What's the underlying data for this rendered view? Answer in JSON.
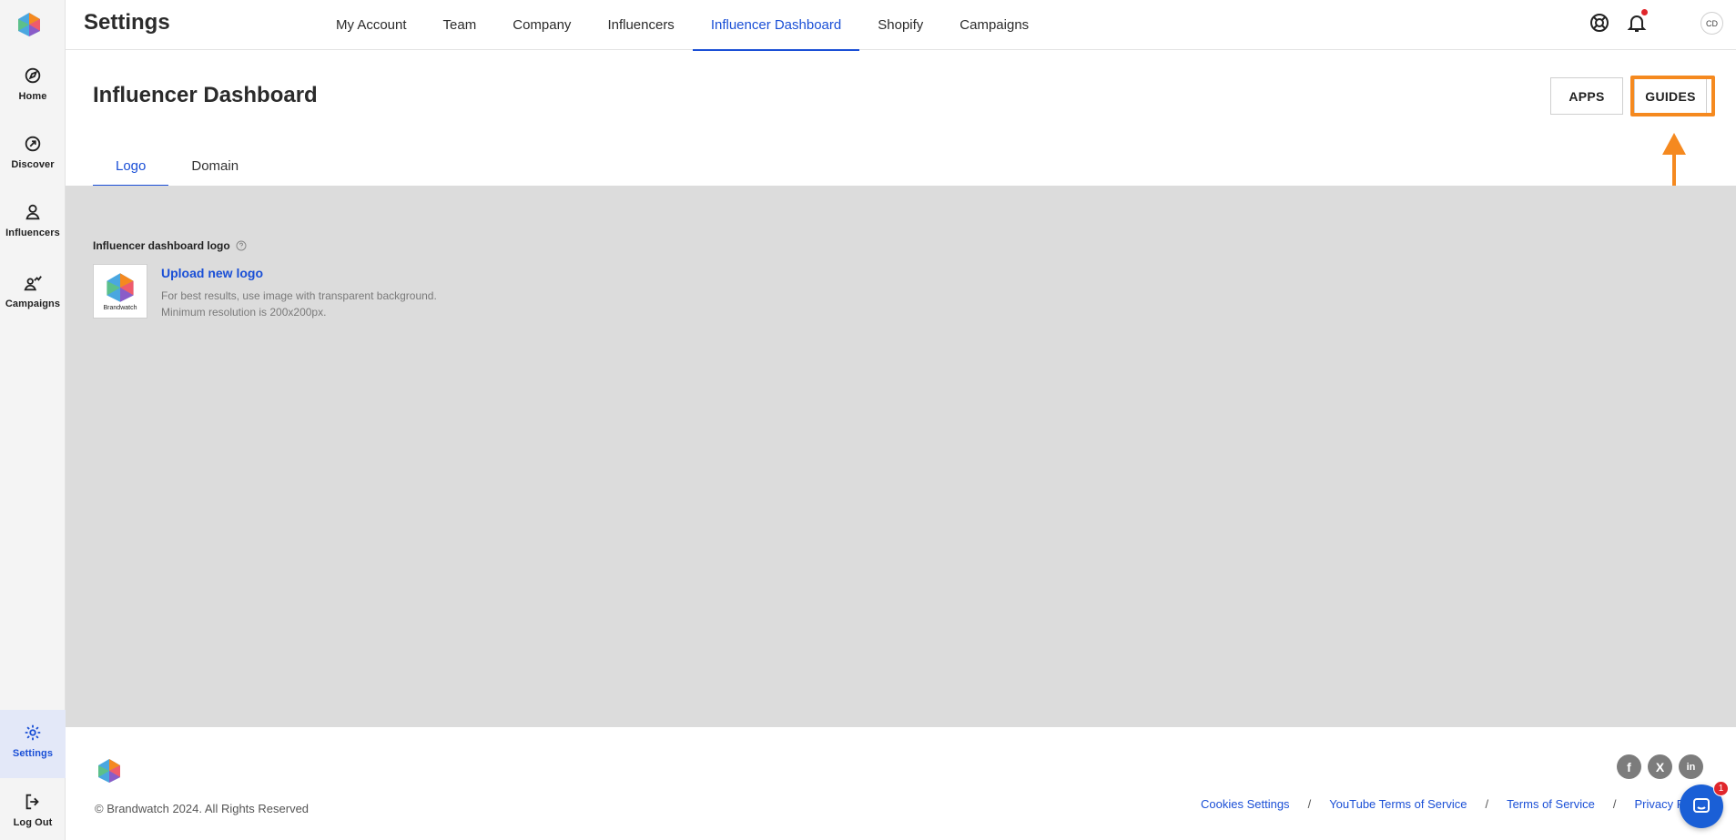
{
  "sidebar": {
    "items": [
      {
        "label": "Home",
        "icon": "compass-icon"
      },
      {
        "label": "Discover",
        "icon": "discover-icon"
      },
      {
        "label": "Influencers",
        "icon": "user-icon"
      },
      {
        "label": "Campaigns",
        "icon": "chart-user-icon"
      },
      {
        "label": "Settings",
        "icon": "gear-icon"
      },
      {
        "label": "Log Out",
        "icon": "logout-icon"
      }
    ]
  },
  "header": {
    "title": "Settings",
    "nav": [
      "My Account",
      "Team",
      "Company",
      "Influencers",
      "Influencer Dashboard",
      "Shopify",
      "Campaigns"
    ],
    "active_nav": "Influencer Dashboard",
    "avatar_initials": "CD"
  },
  "page": {
    "title": "Influencer Dashboard",
    "apps_label": "APPS",
    "guides_label": "GUIDES",
    "tabs": [
      "Logo",
      "Domain"
    ],
    "active_tab": "Logo"
  },
  "logo_section": {
    "label": "Influencer dashboard logo",
    "thumb_text": "Brandwatch",
    "upload_label": "Upload new logo",
    "hint_line1": "For best results, use image with transparent background.",
    "hint_line2": "Minimum resolution is 200x200px."
  },
  "footer": {
    "copyright": "© Brandwatch 2024. All Rights Reserved",
    "social": [
      "f",
      "X",
      "in"
    ],
    "links": [
      "Cookies Settings",
      "YouTube Terms of Service",
      "Terms of Service",
      "Privacy P"
    ],
    "separator": "/",
    "chat_badge": "1"
  },
  "colors": {
    "accent": "#1a4fd6",
    "highlight": "#f5891f",
    "content_bg": "#dcdcdc",
    "sidebar_bg": "#f4f4f4"
  }
}
